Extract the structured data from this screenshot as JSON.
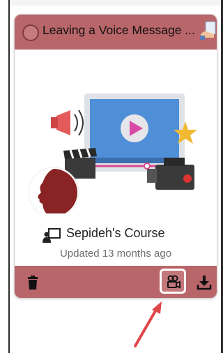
{
  "card": {
    "title": "Leaving a Voice Message ...",
    "author": "Sepideh's Course",
    "updated": "Updated 13 months ago"
  },
  "colors": {
    "card_accent": "#b9666a",
    "highlight_border": "#ffffff",
    "annotation_arrow": "#e0474c"
  },
  "icons": {
    "status": "status-circle-icon",
    "title_badge": "document-hand-icon",
    "author": "teacher-board-icon",
    "delete": "trash-icon",
    "video": "video-camera-icon",
    "download": "download-icon"
  }
}
